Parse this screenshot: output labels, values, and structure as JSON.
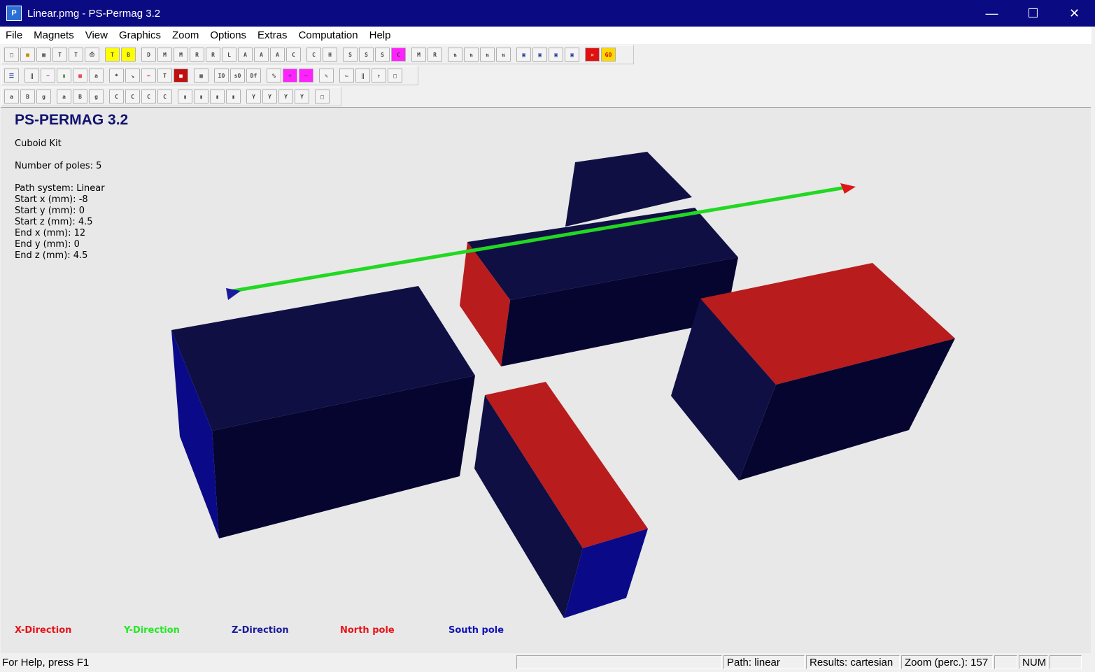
{
  "window": {
    "title": "Linear.pmg - PS-Permag 3.2",
    "app_icon": "P"
  },
  "menu": [
    "File",
    "Magnets",
    "View",
    "Graphics",
    "Zoom",
    "Options",
    "Extras",
    "Computation",
    "Help"
  ],
  "info": {
    "heading": "PS-PERMAG 3.2",
    "kit": "Cuboid Kit",
    "poles": "Number of poles: 5",
    "path_system": "Path system: Linear",
    "start_x": "Start x (mm): -8",
    "start_y": "Start y (mm): 0",
    "start_z": "Start z (mm): 4.5",
    "end_x": "End x (mm): 12",
    "end_y": "End y (mm): 0",
    "end_z": "End z (mm): 4.5"
  },
  "legend": {
    "x": {
      "label": "X-Direction",
      "color": "#e8141a"
    },
    "y": {
      "label": "Y-Direction",
      "color": "#25e825"
    },
    "z": {
      "label": "Z-Direction",
      "color": "#1a1a9a"
    },
    "north": {
      "label": "North pole",
      "color": "#e8141a"
    },
    "south": {
      "label": "South pole",
      "color": "#1212b8"
    }
  },
  "colors": {
    "north": "#b91c1c",
    "south_top": "#0f0f44",
    "south_front": "#050530",
    "south_side": "#0a0a88"
  },
  "status": {
    "help": "For Help, press F1",
    "path": "Path: linear",
    "results": "Results: cartesian",
    "zoom": "Zoom (perc.): 157",
    "num": "NUM"
  }
}
